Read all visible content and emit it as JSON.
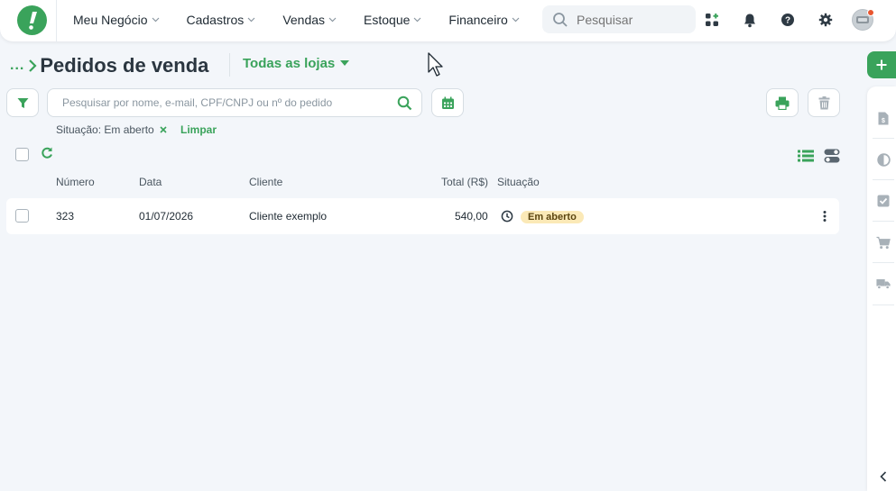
{
  "nav": {
    "items": [
      {
        "label": "Meu Negócio"
      },
      {
        "label": "Cadastros"
      },
      {
        "label": "Vendas"
      },
      {
        "label": "Estoque"
      },
      {
        "label": "Financeiro"
      }
    ],
    "search_placeholder": "Pesquisar"
  },
  "page": {
    "breadcrumb_more": "...",
    "title": "Pedidos de venda",
    "store_selector": "Todas as lojas"
  },
  "search": {
    "placeholder": "Pesquisar por nome, e-mail, CPF/CNPJ ou nº do pedido"
  },
  "filters": {
    "active": "Situação: Em aberto",
    "clear_label": "Limpar"
  },
  "table": {
    "headers": {
      "number": "Número",
      "date": "Data",
      "client": "Cliente",
      "total": "Total (R$)",
      "status": "Situação"
    },
    "rows": [
      {
        "number": "323",
        "date": "01/07/2026",
        "client": "Cliente exemplo",
        "total": "540,00",
        "status": "Em aberto"
      }
    ]
  },
  "colors": {
    "brand_green": "#3aa35b",
    "status_open_bg": "#fbe9b7",
    "background": "#f3f6fa"
  },
  "icons": {
    "logo": "exclamation-logo-icon",
    "search": "magnifier-icon",
    "apps": "apps-grid-icon",
    "notifications": "bell-icon",
    "help": "question-icon",
    "settings": "gear-icon",
    "filter": "funnel-icon",
    "calendar": "calendar-icon",
    "print": "printer-icon",
    "delete": "trash-icon",
    "refresh": "refresh-icon",
    "list_view": "list-icon",
    "toggle_view": "toggle-icon",
    "status_clock": "clock-icon",
    "row_menu": "kebab-icon"
  }
}
